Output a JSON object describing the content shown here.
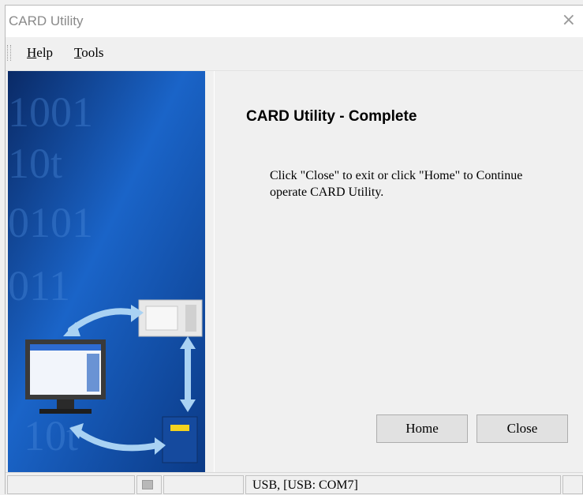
{
  "window": {
    "title": "CARD Utility",
    "close_glyph": "×"
  },
  "menu": [
    {
      "label": "Help",
      "underline": "H",
      "rest": "elp"
    },
    {
      "label": "Tools",
      "underline": "T",
      "rest": "ools"
    }
  ],
  "sidebar": {
    "binary_lines": [
      "1001",
      "10t",
      "0101",
      "011",
      "10t"
    ]
  },
  "main": {
    "heading": "CARD Utility - Complete",
    "message": "Click \"Close\" to exit or click \"Home\" to Continue operate CARD Utility.",
    "home_label": "Home",
    "close_label": "Close"
  },
  "statusbar": {
    "connection": "USB, [USB: COM7]"
  },
  "colors": {
    "accent_blue": "#1c5fb8",
    "arrow": "#a9d2f3"
  }
}
